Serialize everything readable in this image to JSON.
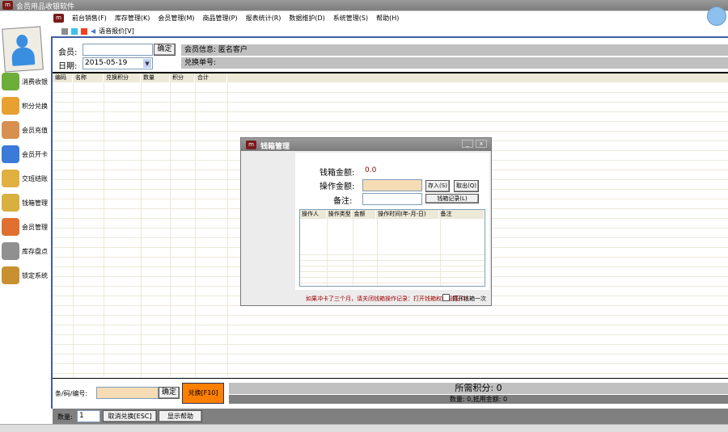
{
  "app": {
    "title": "会员用品收银软件"
  },
  "menu": [
    "前台销售(F)",
    "库存管理(K)",
    "会员管理(M)",
    "商品管理(P)",
    "报表统计(R)",
    "数据维护(D)",
    "系统管理(S)",
    "帮助(H)"
  ],
  "toolbar": {
    "colors": [
      "#8c8c8c",
      "#3fbfef",
      "#f04020"
    ],
    "sound_label": "语音报价[V]"
  },
  "form": {
    "member_label": "会员:",
    "member_value": "",
    "confirm": "确定",
    "member_info": "会员信息: 匿名客户",
    "date_label": "日期:",
    "date_value": "2015-05-19",
    "order_label": "兑换单号:"
  },
  "sidebar": [
    {
      "label": "消费收银",
      "icon": "price-tag-icon",
      "color": "#6cae3a"
    },
    {
      "label": "积分兑换",
      "icon": "gift-box-icon",
      "color": "#e8a030"
    },
    {
      "label": "会员充值",
      "icon": "basket-icon",
      "color": "#d89050"
    },
    {
      "label": "会员开卡",
      "icon": "cards-icon",
      "color": "#3a7ad8"
    },
    {
      "label": "交班结账",
      "icon": "pencil-money-icon",
      "color": "#e0b040"
    },
    {
      "label": "钱箱管理",
      "icon": "coins-icon",
      "color": "#d8b040"
    },
    {
      "label": "会员管理",
      "icon": "people-icon",
      "color": "#e07030"
    },
    {
      "label": "库存盘点",
      "icon": "warehouse-icon",
      "color": "#909090"
    },
    {
      "label": "锁定系统",
      "icon": "lock-icon",
      "color": "#c89030"
    }
  ],
  "grid": {
    "columns": [
      "编码",
      "名称",
      "兑换积分",
      "数量",
      "积分",
      "合计"
    ]
  },
  "dialog": {
    "title": "钱箱管理",
    "balance_label": "钱箱金额:",
    "balance_value": "0.0",
    "amount_label": "操作金额:",
    "amount_value": "",
    "note_label": "备注:",
    "note_value": "",
    "deposit": "存入(S)",
    "withdraw": "取出(Q)",
    "records": "钱箱记录(L)",
    "columns": [
      "操作人",
      "操作类型",
      "金额",
      "操作时间(年-月-日)",
      "备注"
    ],
    "footer_note": "如果冲卡了三个月，请关闭钱箱操作记录：打开钱箱权限设置(O)",
    "checkbox_label": "打开钱箱一次",
    "checked": false
  },
  "bottom": {
    "code_label": "条/码/编号:",
    "code_value": "",
    "confirm": "确定",
    "redeem": "兑换[F10]",
    "points": "所需积分: 0",
    "summary": "数量: 0,抵用金额: 0",
    "qty_label": "数量:",
    "qty_value": "1",
    "cancel": "取消兑换[ESC]",
    "help": "显示帮助"
  }
}
